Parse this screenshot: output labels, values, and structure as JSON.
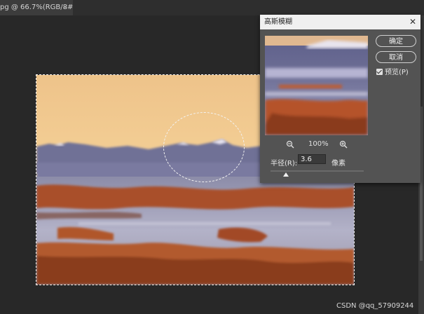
{
  "document_tab": {
    "title": "pg @ 66.7%(RGB/8#) *",
    "close": "×"
  },
  "dialog": {
    "title": "高斯模糊",
    "close": "✕",
    "ok_label": "确定",
    "cancel_label": "取消",
    "preview_label": "预览(P)",
    "preview_checked": true,
    "zoom_percent": "100%",
    "zoom_out_icon": "zoom-out-icon",
    "zoom_in_icon": "zoom-in-icon",
    "radius_label": "半径(R):",
    "radius_value": "3.6",
    "radius_unit": "像素"
  },
  "colors": {
    "workspace": "#282828",
    "dialog_bg": "#535353",
    "sky_top": "#f0c78c",
    "sky_bottom": "#f5d9a0",
    "mountains": "#6b6f9a",
    "brush": "#b0532a",
    "ground": "#a7a9c4"
  },
  "watermark": "CSDN @qq_57909244"
}
